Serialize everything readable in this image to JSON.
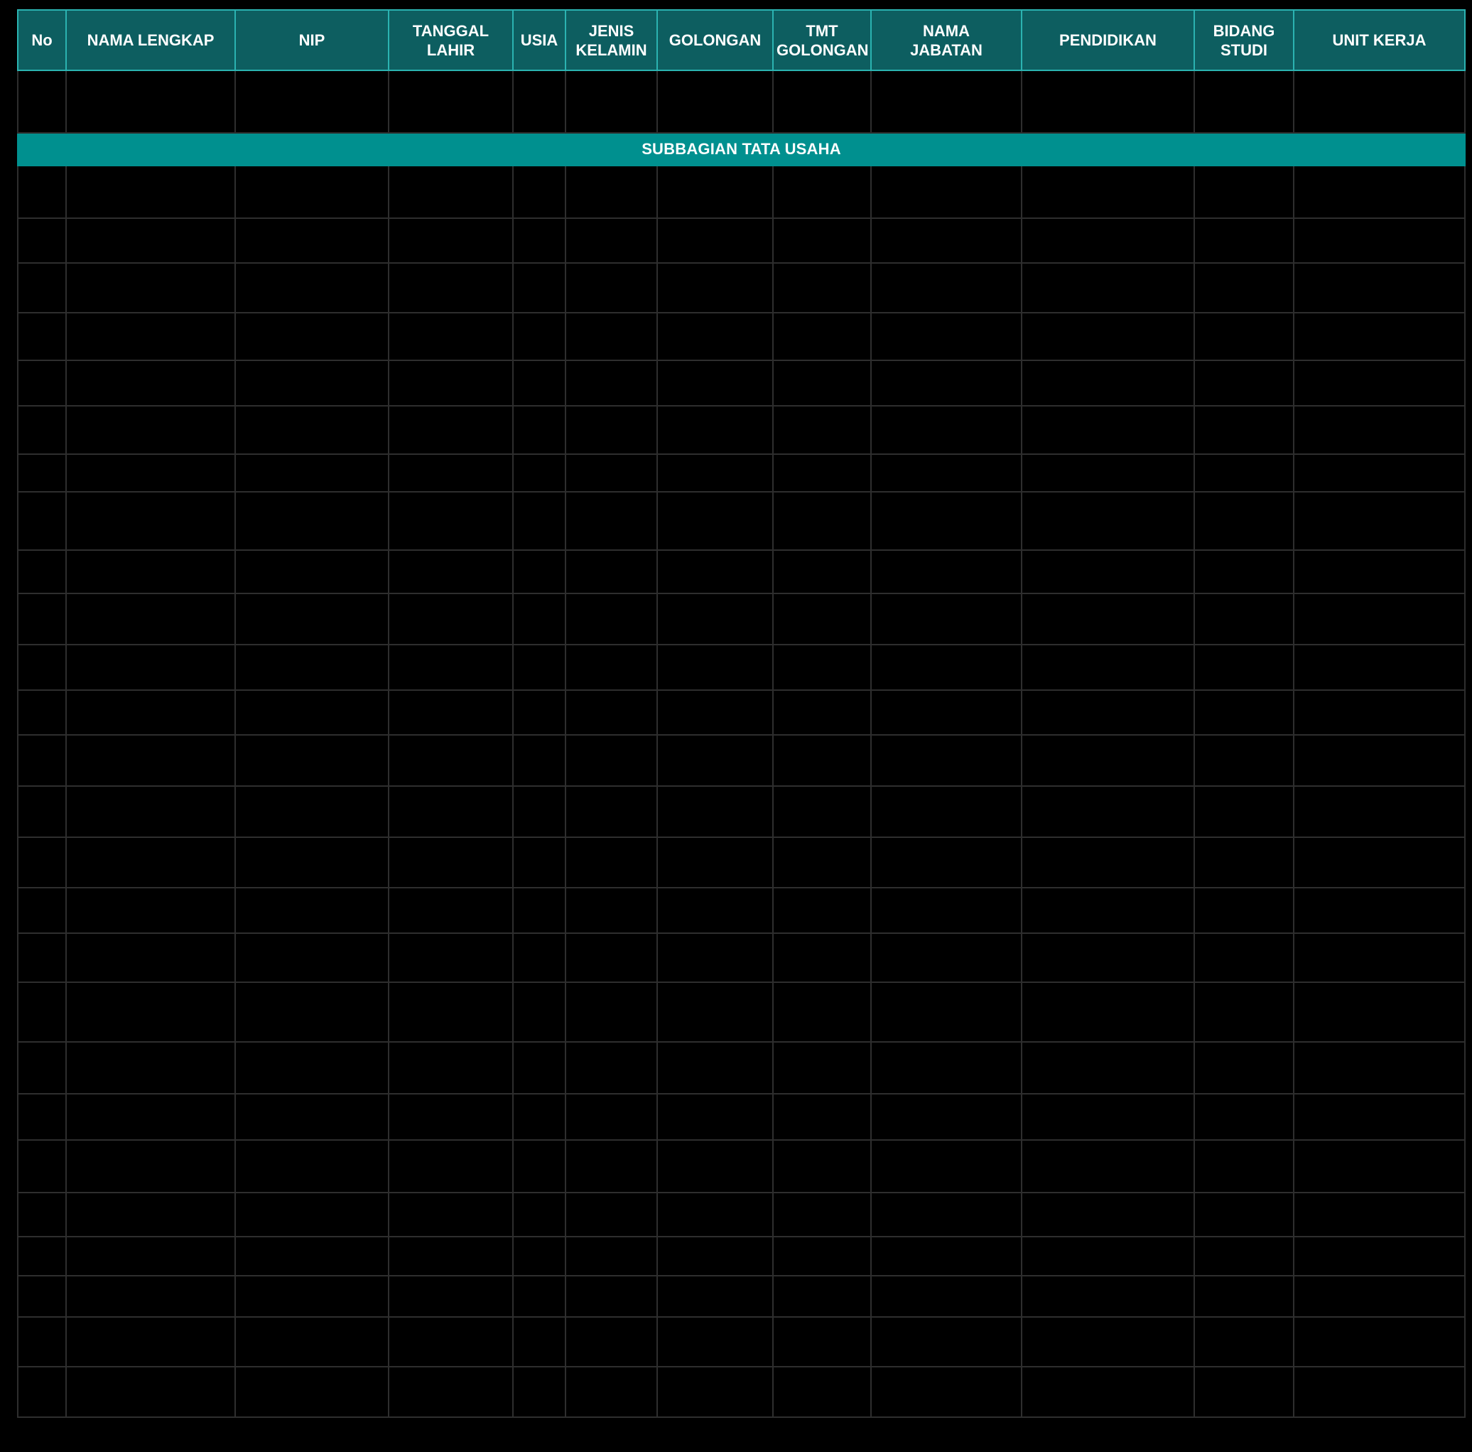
{
  "table": {
    "headers": [
      "No",
      "NAMA LENGKAP",
      "NIP",
      "TANGGAL\nLAHIR",
      "USIA",
      "JENIS\nKELAMIN",
      "GOLONGAN",
      "TMT\nGOLONGAN",
      "NAMA\nJABATAN",
      "PENDIDIKAN",
      "BIDANG\nSTUDI",
      "UNIT KERJA"
    ],
    "section_title": "SUBBAGIAN TATA USAHA"
  },
  "colors": {
    "header_bg": "#0d5e60",
    "header_border": "#2bb3b1",
    "section_bg": "#00908f",
    "grid_line": "#2e2e2e",
    "background": "#000000"
  }
}
